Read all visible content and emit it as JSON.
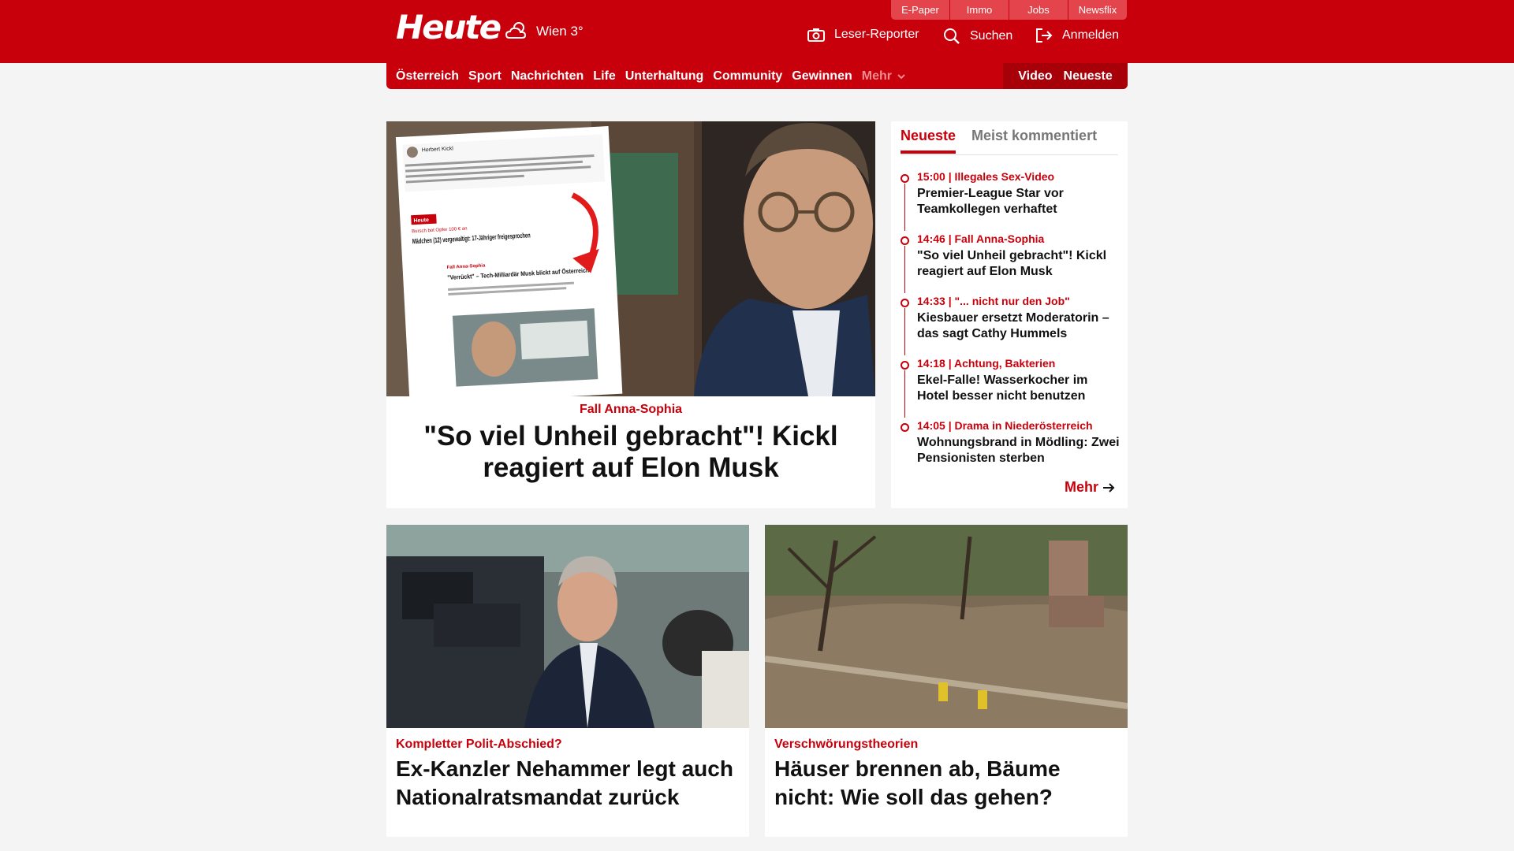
{
  "header": {
    "logo": "Heute",
    "weather": "Wien 3°",
    "services": [
      "E-Paper",
      "Immo",
      "Jobs",
      "Newsflix"
    ],
    "leser_reporter": "Leser-Reporter",
    "search": "Suchen",
    "login": "Anmelden"
  },
  "nav": {
    "items": [
      "Österreich",
      "Sport",
      "Nachrichten",
      "Life",
      "Unterhaltung",
      "Community",
      "Gewinnen"
    ],
    "more": "Mehr",
    "video": "Video",
    "latest": "Neueste"
  },
  "hero": {
    "kicker": "Fall Anna-Sophia",
    "title": "\"So viel Unheil gebracht\"! Kickl reagiert auf Elon Musk"
  },
  "sidebar": {
    "tabs": [
      "Neueste",
      "Meist kommentiert"
    ],
    "items": [
      {
        "meta": "15:00 | Illegales Sex-Video",
        "title": "Premier-League Star vor Teamkollegen verhaftet"
      },
      {
        "meta": "14:46 | Fall Anna-Sophia",
        "title": "\"So viel Unheil gebracht\"! Kickl reagiert auf Elon Musk"
      },
      {
        "meta": "14:33 | \"... nicht nur den Job\"",
        "title": "Kiesbauer ersetzt Moderatorin – das sagt Cathy Hummels"
      },
      {
        "meta": "14:18 | Achtung, Bakterien",
        "title": "Ekel-Falle! Wasserkocher im Hotel besser nicht benutzen"
      },
      {
        "meta": "14:05 | Drama in Niederösterreich",
        "title": "Wohnungsbrand in Mödling: Zwei Pensionisten sterben"
      }
    ],
    "more": "Mehr"
  },
  "articles": [
    {
      "kicker": "Kompletter Polit-Abschied?",
      "title": "Ex-Kanzler Nehammer legt auch Nationalratsmandat zurück"
    },
    {
      "kicker": "Verschwörungstheorien",
      "title": "Häuser brennen ab, Bäume nicht: Wie soll das gehen?"
    }
  ],
  "embed": {
    "author": "Herbert Kickl",
    "logo": "Heute",
    "label": "Bursch bot Opfer 100 € an",
    "headline": "Mädchen (12) vergewaltigt: 17-Jähriger freigesprochen",
    "kicker2": "Fall Anna-Sophia",
    "headline2": "\"Verrückt\" – Tech-Milliardär Musk blickt auf Österreich"
  },
  "colors": {
    "brand": "#c8000b",
    "brand_dark": "#a80009",
    "service_tab": "#e4454c",
    "background": "#f4f4f4"
  }
}
